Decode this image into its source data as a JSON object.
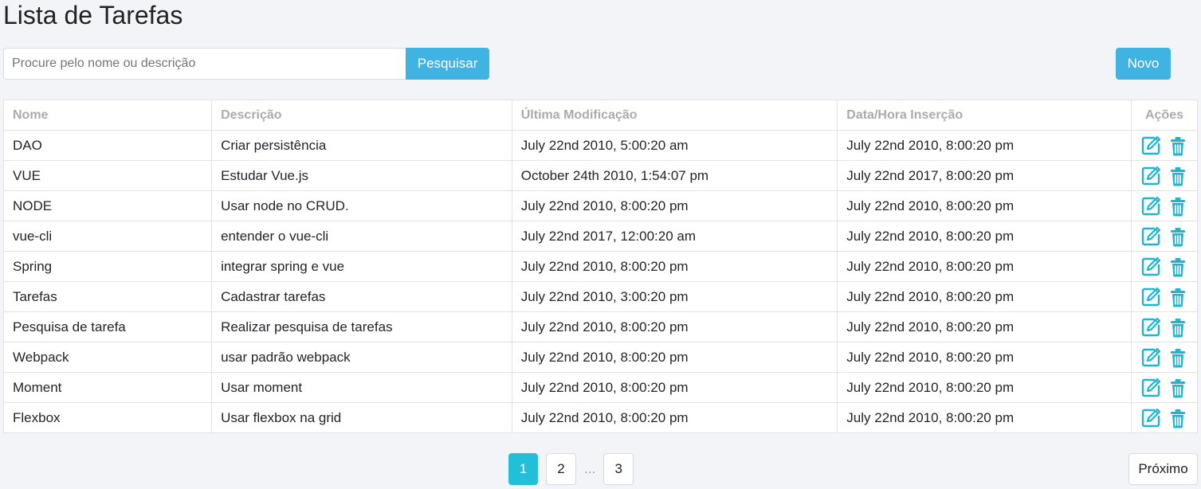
{
  "page": {
    "title": "Lista de Tarefas"
  },
  "search": {
    "placeholder": "Procure pelo nome ou descrição",
    "value": "",
    "button_label": "Pesquisar"
  },
  "toolbar": {
    "new_label": "Novo"
  },
  "table": {
    "headers": [
      "Nome",
      "Descrição",
      "Última Modificação",
      "Data/Hora Inserção",
      "Ações"
    ],
    "rows": [
      [
        "DAO",
        "Criar persistência",
        "July 22nd 2010, 5:00:20 am",
        "July 22nd 2010, 8:00:20 pm"
      ],
      [
        "VUE",
        "Estudar Vue.js",
        "October 24th 2010, 1:54:07 pm",
        "July 22nd 2017, 8:00:20 pm"
      ],
      [
        "NODE",
        "Usar node no CRUD.",
        "July 22nd 2010, 8:00:20 pm",
        "July 22nd 2010, 8:00:20 pm"
      ],
      [
        "vue-cli",
        "entender o vue-cli",
        "July 22nd 2017, 12:00:20 am",
        "July 22nd 2010, 8:00:20 pm"
      ],
      [
        "Spring",
        "integrar spring e vue",
        "July 22nd 2010, 8:00:20 pm",
        "July 22nd 2010, 8:00:20 pm"
      ],
      [
        "Tarefas",
        "Cadastrar tarefas",
        "July 22nd 2010, 3:00:20 pm",
        "July 22nd 2010, 8:00:20 pm"
      ],
      [
        "Pesquisa de tarefa",
        "Realizar pesquisa de tarefas",
        "July 22nd 2010, 8:00:20 pm",
        "July 22nd 2010, 8:00:20 pm"
      ],
      [
        "Webpack",
        "usar padrão webpack",
        "July 22nd 2010, 8:00:20 pm",
        "July 22nd 2010, 8:00:20 pm"
      ],
      [
        "Moment",
        "Usar moment",
        "July 22nd 2010, 8:00:20 pm",
        "July 22nd 2010, 8:00:20 pm"
      ],
      [
        "Flexbox",
        "Usar flexbox na grid",
        "July 22nd 2010, 8:00:20 pm",
        "July 22nd 2010, 8:00:20 pm"
      ]
    ],
    "row_actions": [
      "edit-icon",
      "trash-icon"
    ]
  },
  "pagination": {
    "pages": [
      "1",
      "2",
      "3"
    ],
    "current": "1",
    "ellipsis": "...",
    "next_label": "Próximo"
  },
  "colors": {
    "primary": "#3fb3e2",
    "active_page": "#22c0d8",
    "action_icon": "#1fb5d0",
    "background": "#f2f4f8"
  }
}
